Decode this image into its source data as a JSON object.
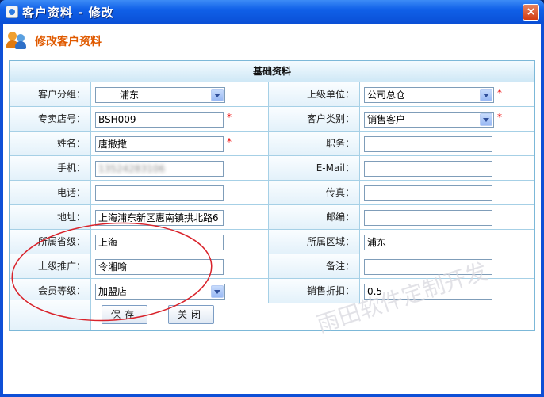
{
  "window": {
    "title": "客户资料 - 修改",
    "close_glyph": "×"
  },
  "header": {
    "title": "修改客户资料",
    "icon": "users-icon"
  },
  "section": {
    "title": "基础资料"
  },
  "fields": {
    "customer_group": {
      "label": "客户分组：",
      "value": "浦东"
    },
    "parent_unit": {
      "label": "上级单位：",
      "value": "公司总仓"
    },
    "store_no": {
      "label": "专卖店号：",
      "value": "BSH009"
    },
    "customer_type": {
      "label": "客户类别：",
      "value": "销售客户"
    },
    "name": {
      "label": "姓名：",
      "value": "唐撒撒"
    },
    "position": {
      "label": "职务：",
      "value": ""
    },
    "mobile": {
      "label": "手机：",
      "value": "13524283106"
    },
    "email": {
      "label": "E-Mail：",
      "value": ""
    },
    "phone": {
      "label": "电话：",
      "value": ""
    },
    "fax": {
      "label": "传真：",
      "value": ""
    },
    "address": {
      "label": "地址：",
      "value": "上海浦东新区惠南镇拱北路6"
    },
    "zip": {
      "label": "邮编：",
      "value": ""
    },
    "province": {
      "label": "所属省级：",
      "value": "上海"
    },
    "region": {
      "label": "所属区域：",
      "value": "浦东"
    },
    "referrer": {
      "label": "上级推广：",
      "value": "令湘喻"
    },
    "remark": {
      "label": "备注：",
      "value": ""
    },
    "member_level": {
      "label": "会员等级：",
      "value": "加盟店"
    },
    "discount": {
      "label": "销售折扣：",
      "value": "0.5"
    }
  },
  "required_mark": "*",
  "buttons": {
    "save": "保存",
    "close": "关闭"
  },
  "watermark": "雨田软件定制开发",
  "colors": {
    "title_bar": "#0a4fd6",
    "header_text": "#e05a00",
    "border": "#7cb8d8",
    "annotation": "#d9232b"
  }
}
